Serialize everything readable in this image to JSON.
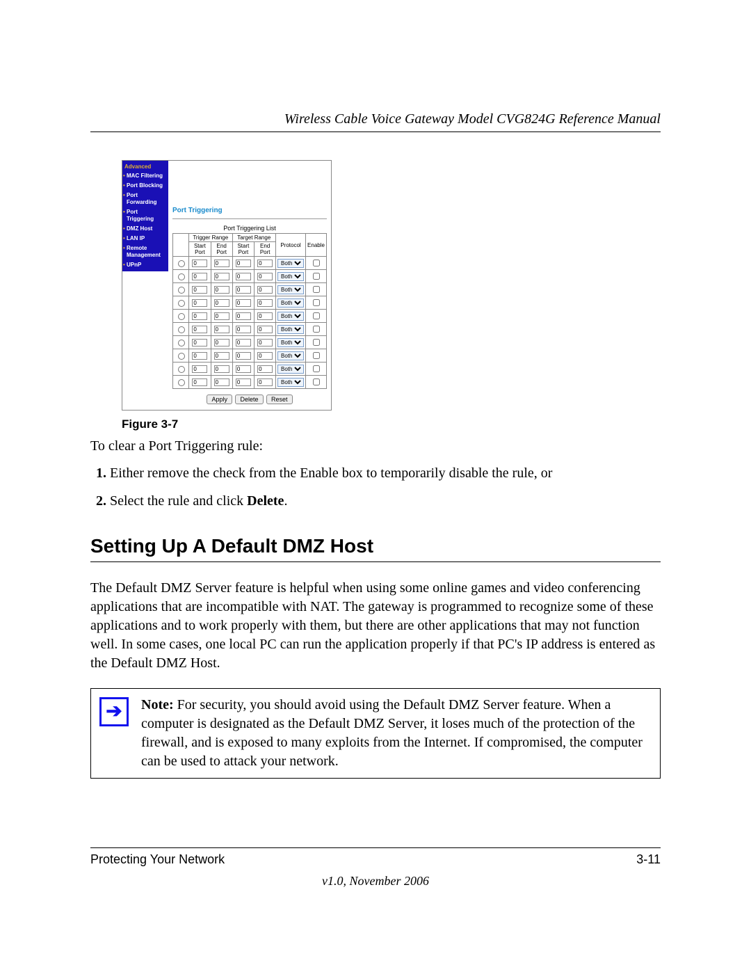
{
  "header": {
    "title": "Wireless Cable Voice Gateway Model CVG824G Reference Manual"
  },
  "router": {
    "nav_head": "Advanced",
    "nav_items": [
      "MAC Filtering",
      "Port Blocking",
      "Port Forwarding",
      "Port Triggering",
      "DMZ Host",
      "LAN IP",
      "Remote Management",
      "UPnP"
    ],
    "panel_title": "Port Triggering",
    "list_title": "Port Triggering List",
    "cols": {
      "trigger": "Trigger Range",
      "target": "Target Range",
      "start": "Start Port",
      "end": "End Port",
      "protocol": "Protocol",
      "enable": "Enable"
    },
    "row_default": {
      "v": "0",
      "proto": "Both"
    },
    "row_count": 10,
    "buttons": {
      "apply": "Apply",
      "delete": "Delete",
      "reset": "Reset"
    }
  },
  "figure_caption": "Figure 3-7",
  "intro": "To clear a Port Triggering rule:",
  "steps": [
    "Either remove the check from the Enable box to temporarily disable the rule, or",
    "Select the rule and click <b>Delete</b>."
  ],
  "section_heading": "Setting Up A Default DMZ Host",
  "section_body": "The Default DMZ Server feature is helpful when using some online games and video conferencing applications that are incompatible with NAT. The gateway is programmed to recognize some of these applications and to work properly with them, but there are other applications that may not function well. In some cases, one local PC can run the application properly if that PC's IP address is entered as the Default DMZ Host.",
  "note": {
    "label": "Note:",
    "text": "For security, you should avoid using the Default DMZ Server feature. When a computer is designated as the Default DMZ Server, it loses much of the protection of the firewall, and is exposed to many exploits from the Internet. If compromised, the computer can be used to attack your network."
  },
  "footer": {
    "chapter": "Protecting Your Network",
    "page": "3-11",
    "version": "v1.0, November 2006"
  }
}
